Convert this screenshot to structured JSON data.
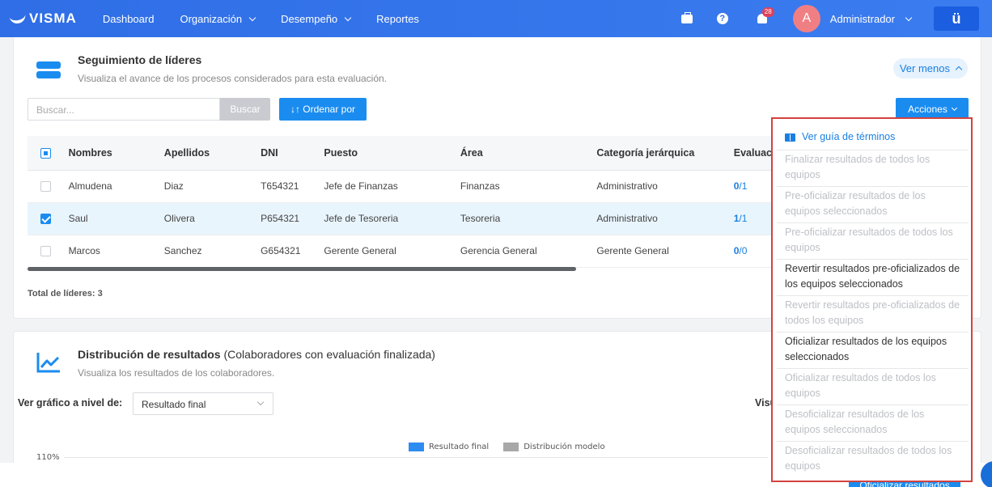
{
  "nav": {
    "logo": "VISMA",
    "items": [
      {
        "label": "Dashboard",
        "dropdown": false
      },
      {
        "label": "Organización",
        "dropdown": true
      },
      {
        "label": "Desempeño",
        "dropdown": true
      },
      {
        "label": "Reportes",
        "dropdown": false
      }
    ],
    "notifications_count": "28",
    "avatar_initial": "A",
    "user_name": "Administrador",
    "help_glyph": "?",
    "app_button": "ü"
  },
  "leaders": {
    "title": "Seguimiento de líderes",
    "subtitle": "Visualiza el avance de los procesos considerados para esta evaluación.",
    "toggle_label": "Ver menos",
    "search_placeholder": "Buscar...",
    "search_button": "Buscar",
    "order_button": "↓↑ Ordenar por",
    "actions_button": "Acciones",
    "columns": [
      "Nombres",
      "Apellidos",
      "DNI",
      "Puesto",
      "Área",
      "Categoría jerárquica",
      "Evaluac"
    ],
    "rows": [
      {
        "selected": false,
        "nombres": "Almudena",
        "apellidos": "Diaz",
        "dni": "T654321",
        "puesto": "Jefe de Finanzas",
        "area": "Finanzas",
        "categoria": "Administrativo",
        "ev_done": "0",
        "ev_total": "/1"
      },
      {
        "selected": true,
        "nombres": "Saul",
        "apellidos": "Olivera",
        "dni": "P654321",
        "puesto": "Jefe de Tesoreria",
        "area": "Tesoreria",
        "categoria": "Administrativo",
        "ev_done": "1",
        "ev_total": "/1"
      },
      {
        "selected": false,
        "nombres": "Marcos",
        "apellidos": "Sanchez",
        "dni": "G654321",
        "puesto": "Gerente General",
        "area": "Gerencia General",
        "categoria": "Gerente General",
        "ev_done": "0",
        "ev_total": "/0"
      }
    ],
    "total_label": "Total de líderes: 3"
  },
  "distribution": {
    "title": "Distribución de resultados",
    "title_suffix": " (Colaboradores con evaluación finalizada)",
    "subtitle": "Visualiza los resultados de los colaboradores.",
    "level_label": "Ver gráfico a nivel de:",
    "level_value": "Resultado final",
    "right_label": "Visu",
    "legend_final": "Resultado final",
    "legend_model": "Distribución modelo",
    "y_tick_top": "110%",
    "colors": {
      "final": "#2d8cf0",
      "model": "#a8a8a8"
    }
  },
  "actions_menu": {
    "guide": "Ver guía de términos",
    "items": [
      {
        "label": "Finalizar resultados de todos los equipos",
        "enabled": false
      },
      {
        "label": "Pre-oficializar resultados de los equipos seleccionados",
        "enabled": false
      },
      {
        "label": "Pre-oficializar resultados de todos los equipos",
        "enabled": false
      },
      {
        "label": "Revertir resultados pre-oficializados de los equipos seleccionados",
        "enabled": true
      },
      {
        "label": "Revertir resultados pre-oficializados de todos los equipos",
        "enabled": false
      },
      {
        "label": "Oficializar resultados de los equipos seleccionados",
        "enabled": true
      },
      {
        "label": "Oficializar resultados de todos los equipos",
        "enabled": false
      },
      {
        "label": "Desoficializar resultados de los equipos seleccionados",
        "enabled": false
      },
      {
        "label": "Desoficializar resultados de todos los equipos",
        "enabled": false
      }
    ]
  },
  "footer": {
    "primary_button": "Oficializar resultados"
  }
}
